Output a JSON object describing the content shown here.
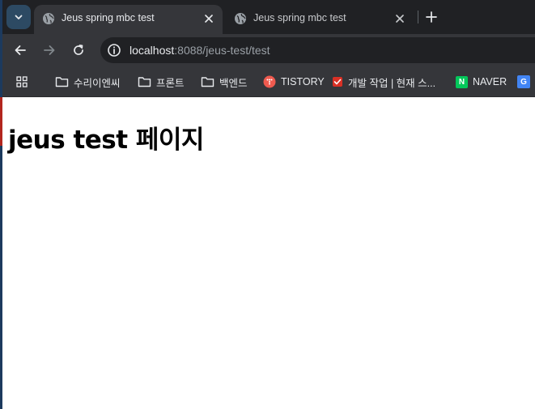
{
  "colors": {
    "tabstrip_bg": "#202124",
    "toolbar_bg": "#35363a",
    "omnibox_bg": "#202124",
    "tistory_red": "#ef5a4f",
    "naver_green": "#03c75a",
    "google_blue": "#4285f4"
  },
  "tabs": [
    {
      "title": "Jeus spring mbc test",
      "active": true,
      "icon": "globe-icon"
    },
    {
      "title": "Jeus spring mbc test",
      "active": false,
      "icon": "globe-icon"
    }
  ],
  "toolbar": {
    "url_host": "localhost",
    "url_path": ":8088/jeus-test/test"
  },
  "bookmarks": [
    {
      "label": "수리이엔씨",
      "icon": "folder-icon"
    },
    {
      "label": "프론트",
      "icon": "folder-icon"
    },
    {
      "label": "백엔드",
      "icon": "folder-icon"
    },
    {
      "label": "TISTORY",
      "icon": "tistory-icon"
    },
    {
      "label": "개발 작업 | 현재 스...",
      "icon": "checkbox-icon"
    },
    {
      "label": "NAVER",
      "icon": "naver-icon",
      "badge": "N"
    },
    {
      "label": "",
      "icon": "google-translate-icon",
      "badge": "G"
    }
  ],
  "page": {
    "heading": "jeus test 페이지"
  }
}
